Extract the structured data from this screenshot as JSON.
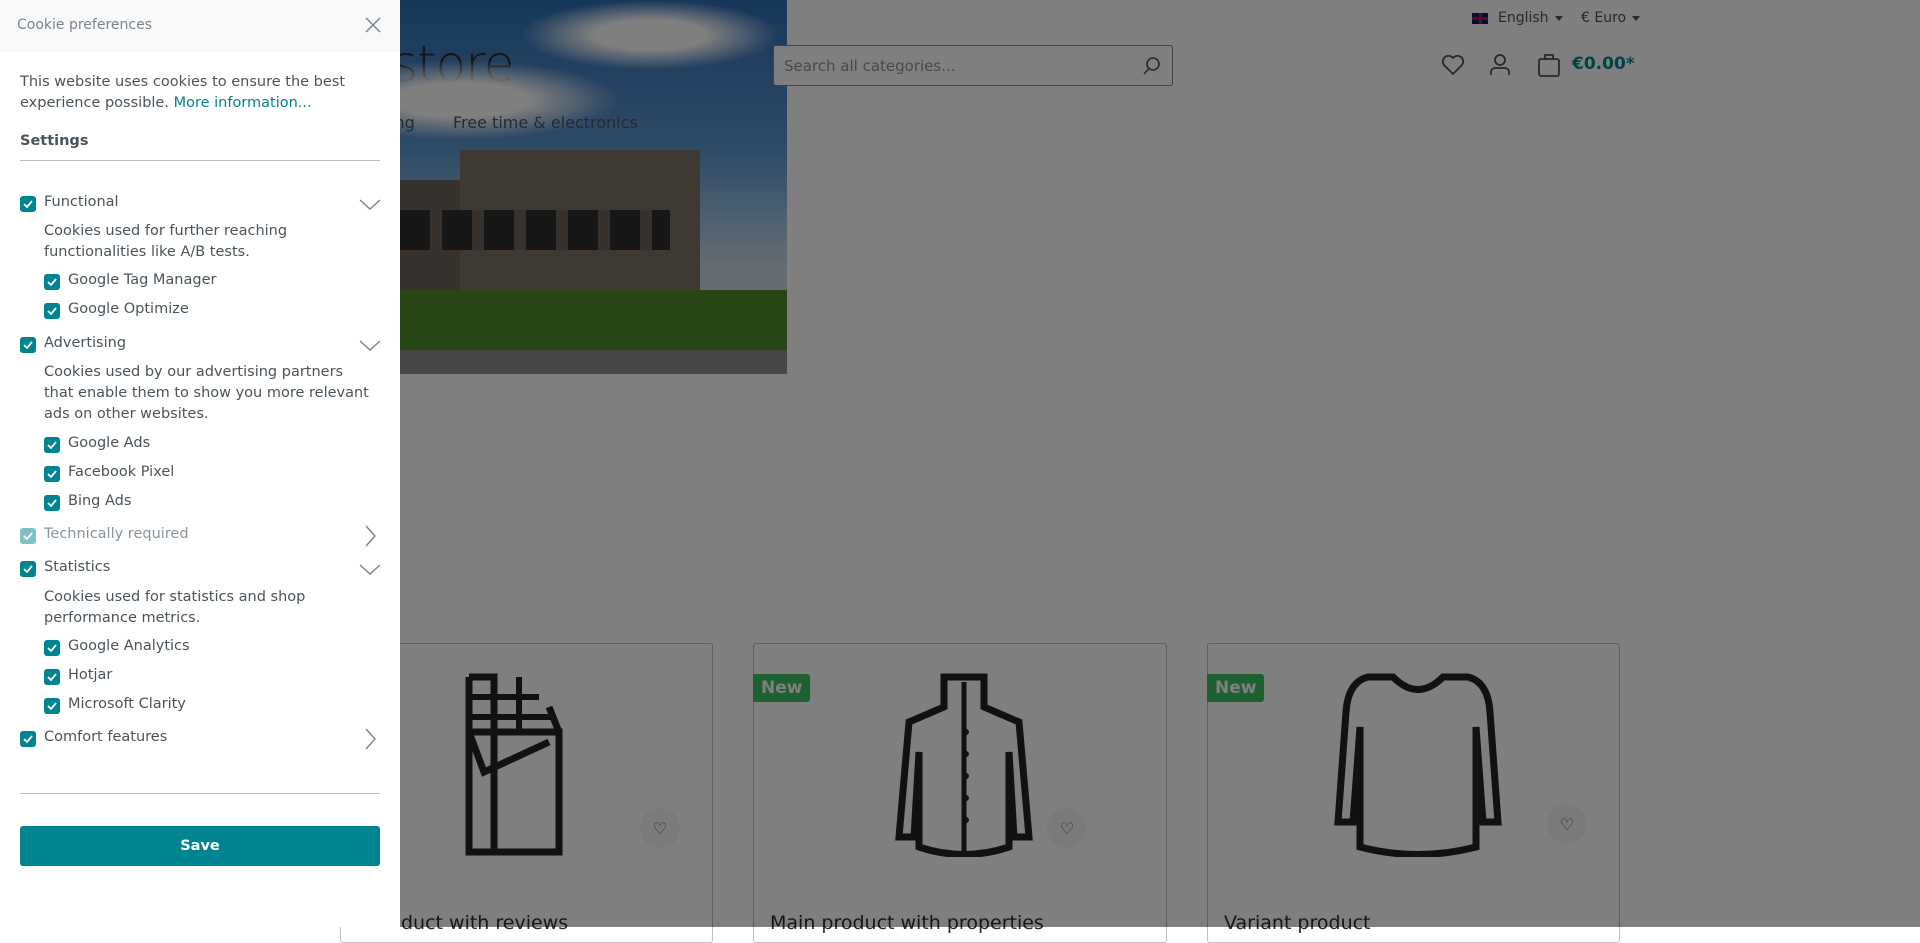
{
  "shop": {
    "language": "English",
    "currency": "€ Euro",
    "logo_fragment": "store",
    "search_placeholder": "Search all categories...",
    "cart_total": "€0.00*",
    "nav": [
      "ing",
      "Free time & electronics"
    ],
    "products": [
      {
        "title": "duct with reviews",
        "badge": "",
        "icon": "chocolate-icon"
      },
      {
        "title": "Main product with properties",
        "badge": "New",
        "icon": "jacket-icon"
      },
      {
        "title": "Variant product",
        "badge": "New",
        "icon": "sweater-icon"
      }
    ]
  },
  "cookie": {
    "title": "Cookie preferences",
    "intro": "This website uses cookies to ensure the best experience possible.",
    "more_info": "More information...",
    "settings": "Settings",
    "groups": [
      {
        "label": "Functional",
        "checked": true,
        "expanded": true,
        "desc": "Cookies used for further reaching functionalities like A/B tests.",
        "items": [
          "Google Tag Manager",
          "Google Optimize"
        ]
      },
      {
        "label": "Advertising",
        "checked": true,
        "expanded": true,
        "desc": "Cookies used by our advertising partners that enable them to show you more relevant ads on other websites.",
        "items": [
          "Google Ads",
          "Facebook Pixel",
          "Bing Ads"
        ]
      },
      {
        "label": "Technically required",
        "checked": true,
        "disabled": true,
        "expanded": false
      },
      {
        "label": "Statistics",
        "checked": true,
        "expanded": true,
        "desc": "Cookies used for statistics and shop performance metrics.",
        "items": [
          "Google Analytics",
          "Hotjar",
          "Microsoft Clarity"
        ]
      },
      {
        "label": "Comfort features",
        "checked": true,
        "expanded": false
      }
    ],
    "save": "Save"
  },
  "colors": {
    "accent": "#008490",
    "badge": "#3cc261",
    "overlay": "rgba(0,0,0,0.5)"
  }
}
